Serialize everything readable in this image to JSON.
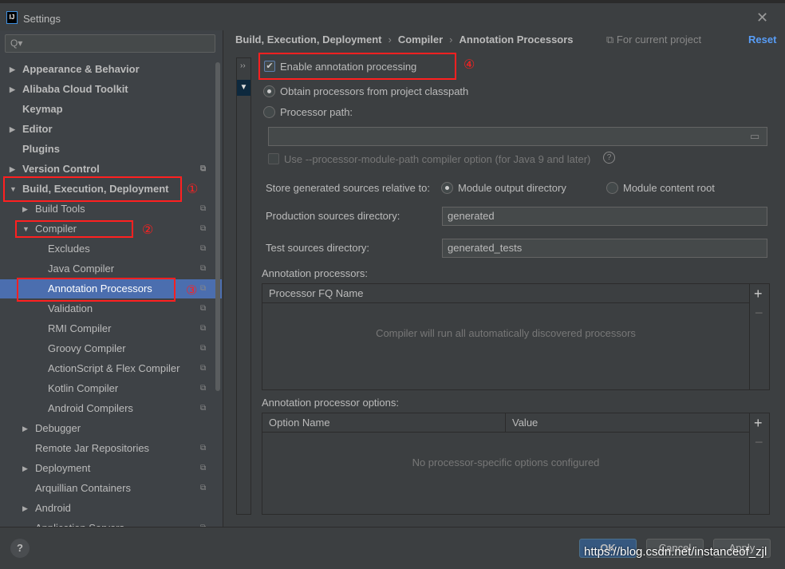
{
  "window": {
    "title": "Settings",
    "app_icon": "IJ"
  },
  "sidebar": {
    "search_placeholder": "Q▾",
    "items": [
      {
        "label": "Appearance & Behavior",
        "arrow": "▶"
      },
      {
        "label": "Alibaba Cloud Toolkit",
        "arrow": "▶"
      },
      {
        "label": "Keymap"
      },
      {
        "label": "Editor",
        "arrow": "▶"
      },
      {
        "label": "Plugins"
      },
      {
        "label": "Version Control",
        "arrow": "▶"
      },
      {
        "label": "Build, Execution, Deployment",
        "arrow": "▼"
      },
      {
        "label": "Build Tools",
        "arrow": "▶"
      },
      {
        "label": "Compiler",
        "arrow": "▼"
      },
      {
        "label": "Excludes"
      },
      {
        "label": "Java Compiler"
      },
      {
        "label": "Annotation Processors"
      },
      {
        "label": "Validation"
      },
      {
        "label": "RMI Compiler"
      },
      {
        "label": "Groovy Compiler"
      },
      {
        "label": "ActionScript & Flex Compiler"
      },
      {
        "label": "Kotlin Compiler"
      },
      {
        "label": "Android Compilers"
      },
      {
        "label": "Debugger",
        "arrow": "▶"
      },
      {
        "label": "Remote Jar Repositories"
      },
      {
        "label": "Deployment",
        "arrow": "▶"
      },
      {
        "label": "Arquillian Containers"
      },
      {
        "label": "Android",
        "arrow": "▶"
      },
      {
        "label": "Application Servers"
      }
    ]
  },
  "annotations": {
    "a1": "①",
    "a2": "②",
    "a3": "③",
    "a4": "④"
  },
  "breadcrumb": {
    "b1": "Build, Execution, Deployment",
    "b2": "Compiler",
    "b3": "Annotation Processors",
    "sep": "›"
  },
  "header": {
    "for_current_project": "For current project",
    "reset": "Reset"
  },
  "form": {
    "enable_annotation": {
      "label": "Enable annotation processing",
      "checked": true
    },
    "obtain_classpath": {
      "label": "Obtain processors from project classpath",
      "selected": true
    },
    "processor_path": {
      "label": "Processor path:",
      "value": ""
    },
    "module_path_option": {
      "label": "Use --processor-module-path compiler option (for Java 9 and later)",
      "checked": false
    },
    "store_relative": {
      "label": "Store generated sources relative to:",
      "opt1": "Module output directory",
      "opt2": "Module content root",
      "selected": "Module output directory"
    },
    "production_dir": {
      "label": "Production sources directory:",
      "value": "generated"
    },
    "test_dir": {
      "label": "Test sources directory:",
      "value": "generated_tests"
    }
  },
  "processors_table": {
    "title": "Annotation processors:",
    "col": "Processor FQ Name",
    "empty": "Compiler will run all automatically discovered processors"
  },
  "options_table": {
    "title": "Annotation processor options:",
    "col1": "Option Name",
    "col2": "Value",
    "empty": "No processor-specific options configured"
  },
  "footer": {
    "help": "?",
    "ok": "OK",
    "cancel": "Cancel",
    "apply": "Apply",
    "watermark": "https://blog.csdn.net/instanceof_zjl"
  }
}
